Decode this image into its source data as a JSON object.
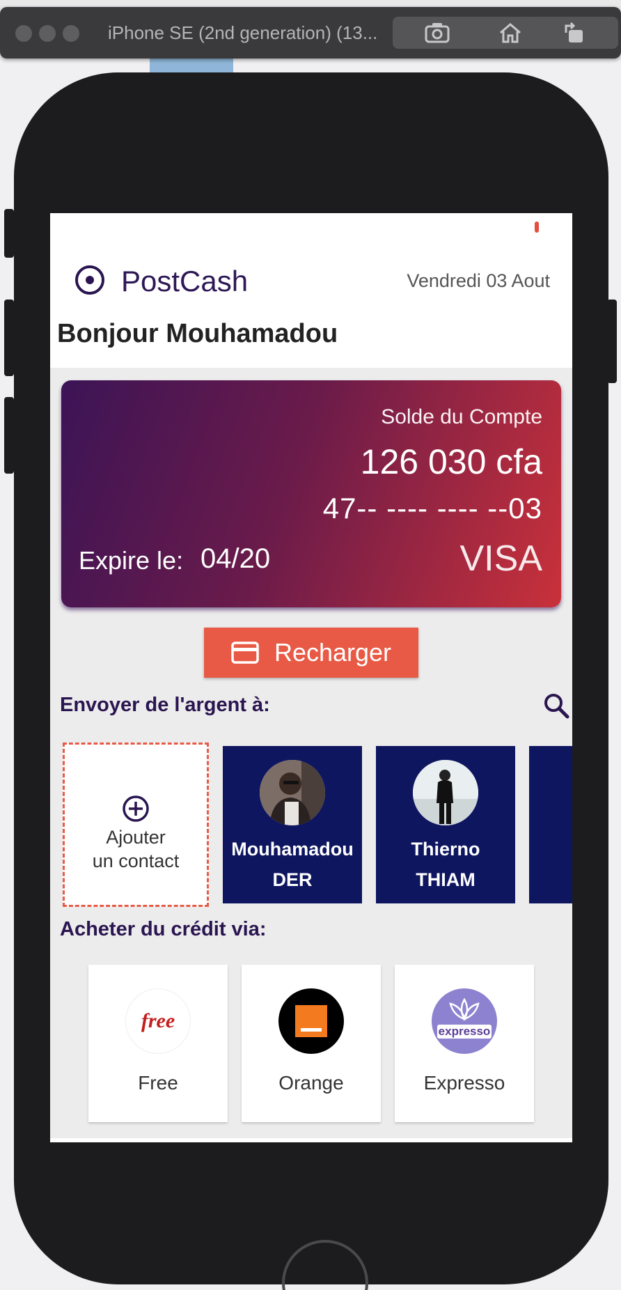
{
  "simulator": {
    "title": "iPhone SE (2nd generation) (13..."
  },
  "app": {
    "brand": "PostCash",
    "date": "Vendredi 03 Aout",
    "greeting": "Bonjour Mouhamadou"
  },
  "card": {
    "balance_label": "Solde du Compte",
    "balance": "126 030 cfa",
    "number": "47-- ---- ---- --03",
    "expiry_label": "Expire le:",
    "expiry": "04/20",
    "brand": "VISA"
  },
  "recharge_button": "Recharger",
  "send": {
    "title": "Envoyer de l'argent à:",
    "add_contact": {
      "line1": "Ajouter",
      "line2": "un contact"
    },
    "contacts": [
      {
        "first": "Mouhamadou",
        "last": "DER"
      },
      {
        "first": "Thierno",
        "last": "THIAM"
      }
    ]
  },
  "credit": {
    "title": "Acheter du crédit via:",
    "operators": [
      {
        "name": "Free",
        "logo_text": "free"
      },
      {
        "name": "Orange"
      },
      {
        "name": "Expresso",
        "logo_text": "expresso"
      }
    ]
  },
  "colors": {
    "primary": "#2a1550",
    "accent": "#e85a45",
    "contact_bg": "#0f1660"
  }
}
